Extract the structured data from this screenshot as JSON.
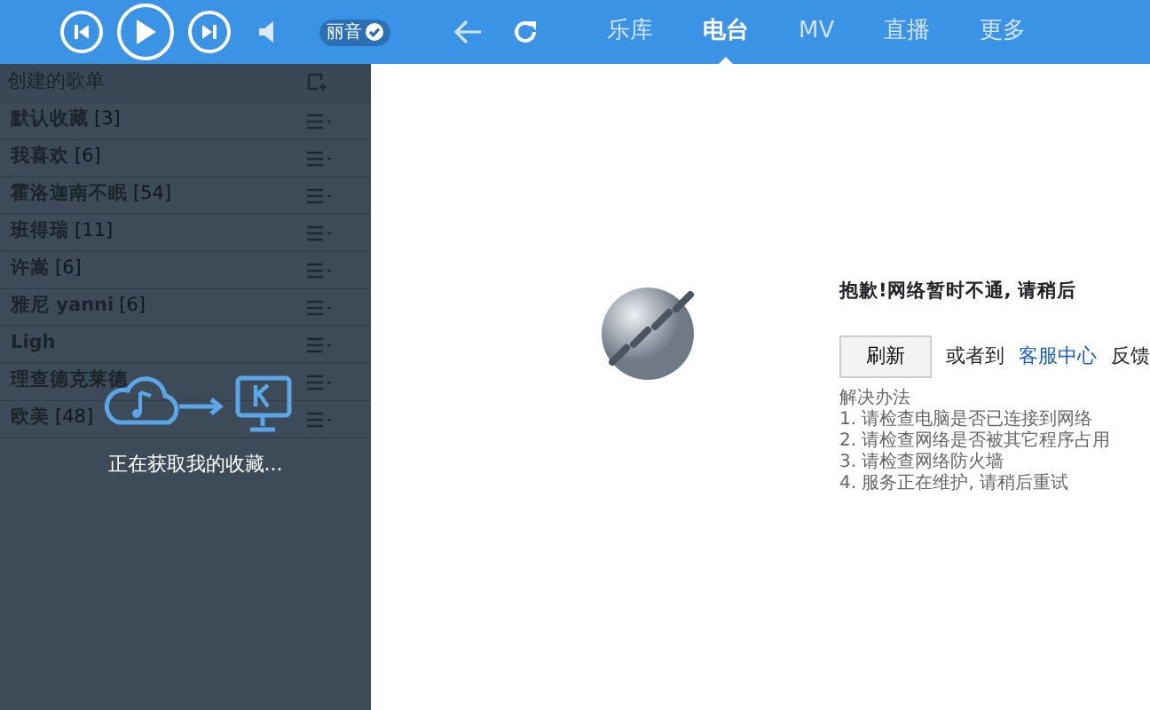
{
  "toolbar": {
    "sound_badge": "丽音"
  },
  "tabs": [
    {
      "label": "乐库",
      "selected": false
    },
    {
      "label": "电台",
      "selected": true
    },
    {
      "label": "MV",
      "selected": false
    },
    {
      "label": "直播",
      "selected": false
    },
    {
      "label": "更多",
      "selected": false
    }
  ],
  "sidebar": {
    "header": "创建的歌单",
    "items": [
      {
        "name": "默认收藏",
        "count": "[3]"
      },
      {
        "name": "我喜欢",
        "count": "[6]"
      },
      {
        "name": "霍洛迦南不眠",
        "count": "[54]"
      },
      {
        "name": "班得瑞",
        "count": "[11]"
      },
      {
        "name": "许嵩",
        "count": "[6]"
      },
      {
        "name": "雅尼 yanni",
        "count": "[6]"
      },
      {
        "name": "Ligh"
      },
      {
        "name": "理查德克莱德"
      },
      {
        "name": "欧美",
        "count": "[48]"
      }
    ],
    "loading_text": "正在获取我的收藏..."
  },
  "error": {
    "title": "抱歉!网络暂时不通, 请稍后",
    "refresh_button": "刷新",
    "or_text": "或者到",
    "link": "客服中心",
    "feedback_text": "反馈",
    "solutions_title": "解决办法",
    "solutions": [
      "1. 请检查电脑是否已连接到网络",
      "2. 请检查网络是否被其它程序占用",
      "3. 请检查网络防火墙",
      "4. 服务正在维护, 请稍后重试"
    ]
  }
}
